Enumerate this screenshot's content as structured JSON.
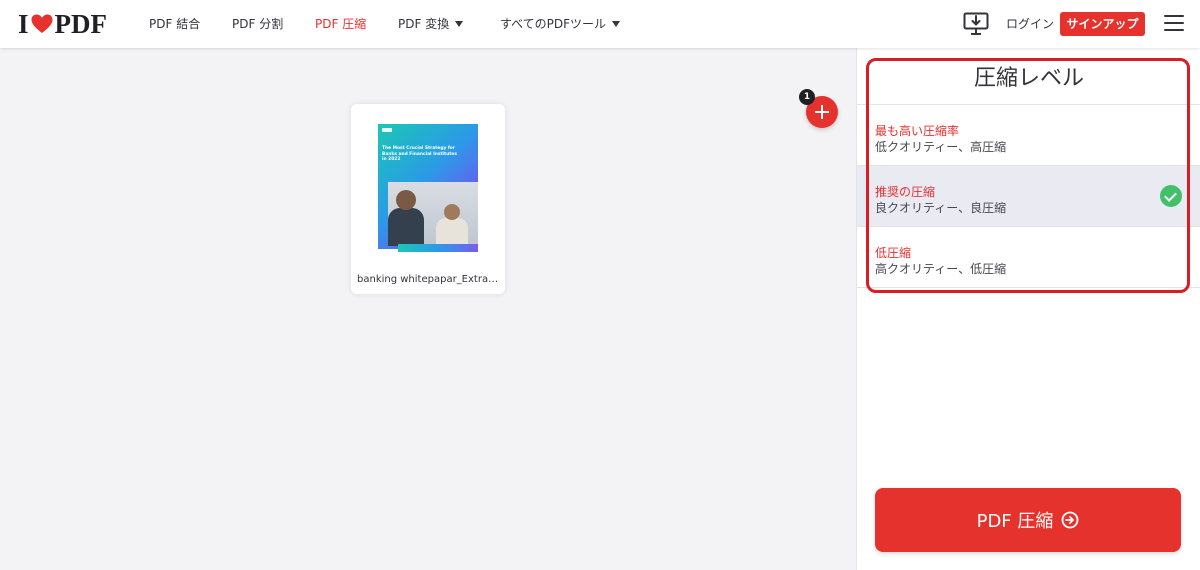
{
  "header": {
    "logo_left": "I",
    "logo_right": "PDF",
    "nav": [
      {
        "label": "PDF 結合",
        "active": false
      },
      {
        "label": "PDF 分割",
        "active": false
      },
      {
        "label": "PDF 圧縮",
        "active": true
      },
      {
        "label": "PDF 変換",
        "active": false,
        "dropdown": true
      },
      {
        "label": "すべてのPDFツール",
        "active": false,
        "dropdown": true
      }
    ],
    "login": "ログイン",
    "signup": "サインアップ",
    "icons": [
      "desktop-download-icon",
      "hamburger-menu-icon"
    ]
  },
  "workspace": {
    "file": {
      "name": "banking whitepapar_Extract.pdf",
      "thumb_title": "The Most Crucial Strategy for Banks and Financial Institutes in 2022"
    },
    "file_count": "1"
  },
  "sidebar": {
    "title": "圧縮レベル",
    "options": [
      {
        "title": "最も高い圧縮率",
        "desc": "低クオリティー、高圧縮",
        "selected": false
      },
      {
        "title": "推奨の圧縮",
        "desc": "良クオリティー、良圧縮",
        "selected": true
      },
      {
        "title": "低圧縮",
        "desc": "高クオリティー、低圧縮",
        "selected": false
      }
    ],
    "action_label": "PDF 圧縮"
  },
  "colors": {
    "brand": "#e5322d",
    "check": "#44c06a",
    "annotation": "#d81e24"
  }
}
